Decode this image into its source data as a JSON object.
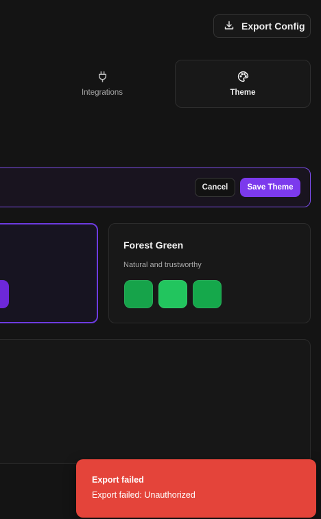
{
  "header": {
    "export_label": "Export Config",
    "export_icon": "download-icon"
  },
  "tabs": [
    {
      "label": "Integrations",
      "icon": "plug-icon",
      "active": false
    },
    {
      "label": "Theme",
      "icon": "palette-icon",
      "active": true
    }
  ],
  "edit_bar": {
    "cancel_label": "Cancel",
    "save_label": "Save Theme"
  },
  "themes": {
    "selected_partial": {
      "swatch_color": "#6d28d9"
    },
    "forest_green": {
      "name": "Forest Green",
      "description": "Natural and trustworthy",
      "swatches": [
        "#16a34a",
        "#22c55e",
        "#15a84b"
      ]
    }
  },
  "toast": {
    "title": "Export failed",
    "message": "Export failed: Unauthorized",
    "color": "#e4443a"
  },
  "colors": {
    "accent": "#7c3aed",
    "background": "#141414"
  }
}
